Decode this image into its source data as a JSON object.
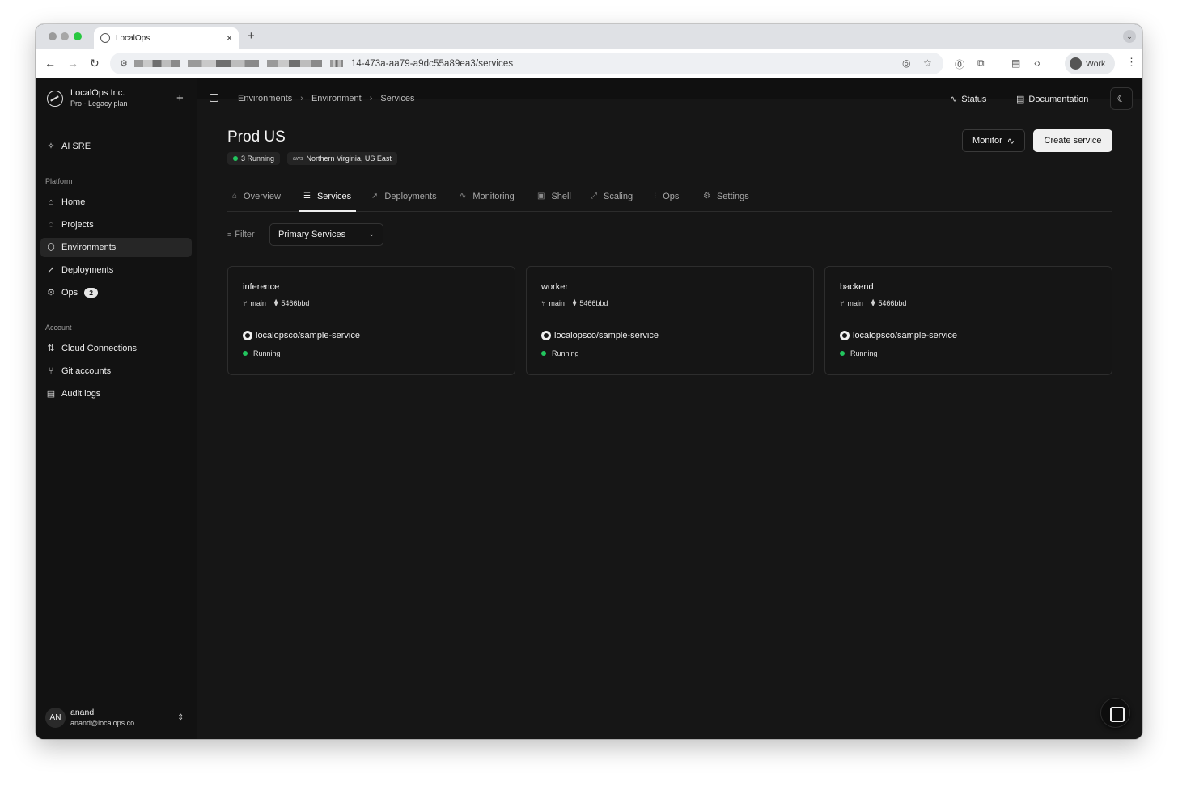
{
  "browser": {
    "tab_title": "LocalOps",
    "url_visible": "14-473a-aa79-a9dc55a89ea3/services",
    "profile_label": "Work"
  },
  "sidebar": {
    "org_name": "LocalOps Inc.",
    "org_plan": "Pro - Legacy plan",
    "ai_item": "AI SRE",
    "platform_heading": "Platform",
    "platform_items": [
      {
        "label": "Home",
        "icon": "home-icon"
      },
      {
        "label": "Projects",
        "icon": "projects-icon"
      },
      {
        "label": "Environments",
        "icon": "cube-icon",
        "active": true
      },
      {
        "label": "Deployments",
        "icon": "rocket-icon"
      },
      {
        "label": "Ops",
        "icon": "gear-icon",
        "badge": "2"
      }
    ],
    "account_heading": "Account",
    "account_items": [
      {
        "label": "Cloud Connections",
        "icon": "cloud-connections-icon"
      },
      {
        "label": "Git accounts",
        "icon": "git-branch-icon"
      },
      {
        "label": "Audit logs",
        "icon": "audit-logs-icon"
      }
    ],
    "user": {
      "initials": "AN",
      "name": "anand",
      "email": "anand@localops.co"
    }
  },
  "topbar": {
    "breadcrumbs": [
      "Environments",
      "Environment",
      "Services"
    ],
    "status_label": "Status",
    "docs_label": "Documentation"
  },
  "page": {
    "title": "Prod US",
    "running_badge": "3 Running",
    "region_badge": "Northern Virginia, US East",
    "monitor_label": "Monitor",
    "create_label": "Create service"
  },
  "tabs": [
    {
      "label": "Overview",
      "icon": "home-icon"
    },
    {
      "label": "Services",
      "icon": "server-icon",
      "active": true
    },
    {
      "label": "Deployments",
      "icon": "rocket-icon"
    },
    {
      "label": "Monitoring",
      "icon": "activity-icon"
    },
    {
      "label": "Shell",
      "icon": "terminal-icon"
    },
    {
      "label": "Scaling",
      "icon": "scaling-icon"
    },
    {
      "label": "Ops",
      "icon": "list-icon"
    },
    {
      "label": "Settings",
      "icon": "gear-icon"
    }
  ],
  "filter": {
    "label": "Filter",
    "selected": "Primary Services"
  },
  "services": [
    {
      "name": "inference",
      "branch": "main",
      "commit": "5466bbd",
      "repo": "localopsco/sample-service",
      "status": "Running"
    },
    {
      "name": "worker",
      "branch": "main",
      "commit": "5466bbd",
      "repo": "localopsco/sample-service",
      "status": "Running"
    },
    {
      "name": "backend",
      "branch": "main",
      "commit": "5466bbd",
      "repo": "localopsco/sample-service",
      "status": "Running"
    }
  ],
  "colors": {
    "running": "#22c55e",
    "background": "#161616",
    "sidebar": "#121212"
  }
}
